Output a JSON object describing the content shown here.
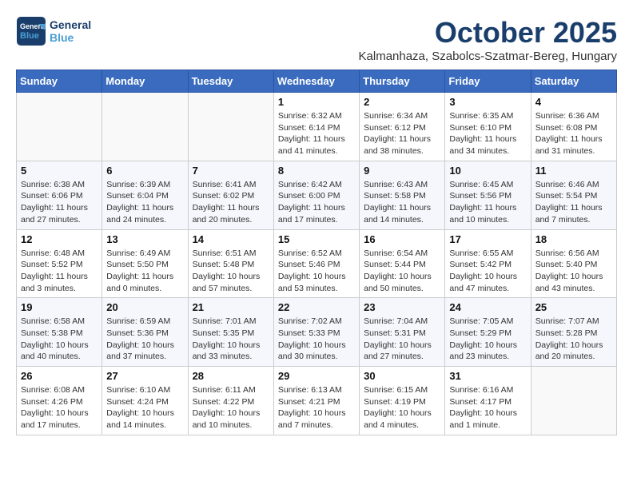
{
  "header": {
    "logo_general": "General",
    "logo_blue": "Blue",
    "month": "October 2025",
    "location": "Kalmanhaza, Szabolcs-Szatmar-Bereg, Hungary"
  },
  "days_of_week": [
    "Sunday",
    "Monday",
    "Tuesday",
    "Wednesday",
    "Thursday",
    "Friday",
    "Saturday"
  ],
  "weeks": [
    [
      {
        "day": "",
        "info": ""
      },
      {
        "day": "",
        "info": ""
      },
      {
        "day": "",
        "info": ""
      },
      {
        "day": "1",
        "info": "Sunrise: 6:32 AM\nSunset: 6:14 PM\nDaylight: 11 hours and 41 minutes."
      },
      {
        "day": "2",
        "info": "Sunrise: 6:34 AM\nSunset: 6:12 PM\nDaylight: 11 hours and 38 minutes."
      },
      {
        "day": "3",
        "info": "Sunrise: 6:35 AM\nSunset: 6:10 PM\nDaylight: 11 hours and 34 minutes."
      },
      {
        "day": "4",
        "info": "Sunrise: 6:36 AM\nSunset: 6:08 PM\nDaylight: 11 hours and 31 minutes."
      }
    ],
    [
      {
        "day": "5",
        "info": "Sunrise: 6:38 AM\nSunset: 6:06 PM\nDaylight: 11 hours and 27 minutes."
      },
      {
        "day": "6",
        "info": "Sunrise: 6:39 AM\nSunset: 6:04 PM\nDaylight: 11 hours and 24 minutes."
      },
      {
        "day": "7",
        "info": "Sunrise: 6:41 AM\nSunset: 6:02 PM\nDaylight: 11 hours and 20 minutes."
      },
      {
        "day": "8",
        "info": "Sunrise: 6:42 AM\nSunset: 6:00 PM\nDaylight: 11 hours and 17 minutes."
      },
      {
        "day": "9",
        "info": "Sunrise: 6:43 AM\nSunset: 5:58 PM\nDaylight: 11 hours and 14 minutes."
      },
      {
        "day": "10",
        "info": "Sunrise: 6:45 AM\nSunset: 5:56 PM\nDaylight: 11 hours and 10 minutes."
      },
      {
        "day": "11",
        "info": "Sunrise: 6:46 AM\nSunset: 5:54 PM\nDaylight: 11 hours and 7 minutes."
      }
    ],
    [
      {
        "day": "12",
        "info": "Sunrise: 6:48 AM\nSunset: 5:52 PM\nDaylight: 11 hours and 3 minutes."
      },
      {
        "day": "13",
        "info": "Sunrise: 6:49 AM\nSunset: 5:50 PM\nDaylight: 11 hours and 0 minutes."
      },
      {
        "day": "14",
        "info": "Sunrise: 6:51 AM\nSunset: 5:48 PM\nDaylight: 10 hours and 57 minutes."
      },
      {
        "day": "15",
        "info": "Sunrise: 6:52 AM\nSunset: 5:46 PM\nDaylight: 10 hours and 53 minutes."
      },
      {
        "day": "16",
        "info": "Sunrise: 6:54 AM\nSunset: 5:44 PM\nDaylight: 10 hours and 50 minutes."
      },
      {
        "day": "17",
        "info": "Sunrise: 6:55 AM\nSunset: 5:42 PM\nDaylight: 10 hours and 47 minutes."
      },
      {
        "day": "18",
        "info": "Sunrise: 6:56 AM\nSunset: 5:40 PM\nDaylight: 10 hours and 43 minutes."
      }
    ],
    [
      {
        "day": "19",
        "info": "Sunrise: 6:58 AM\nSunset: 5:38 PM\nDaylight: 10 hours and 40 minutes."
      },
      {
        "day": "20",
        "info": "Sunrise: 6:59 AM\nSunset: 5:36 PM\nDaylight: 10 hours and 37 minutes."
      },
      {
        "day": "21",
        "info": "Sunrise: 7:01 AM\nSunset: 5:35 PM\nDaylight: 10 hours and 33 minutes."
      },
      {
        "day": "22",
        "info": "Sunrise: 7:02 AM\nSunset: 5:33 PM\nDaylight: 10 hours and 30 minutes."
      },
      {
        "day": "23",
        "info": "Sunrise: 7:04 AM\nSunset: 5:31 PM\nDaylight: 10 hours and 27 minutes."
      },
      {
        "day": "24",
        "info": "Sunrise: 7:05 AM\nSunset: 5:29 PM\nDaylight: 10 hours and 23 minutes."
      },
      {
        "day": "25",
        "info": "Sunrise: 7:07 AM\nSunset: 5:28 PM\nDaylight: 10 hours and 20 minutes."
      }
    ],
    [
      {
        "day": "26",
        "info": "Sunrise: 6:08 AM\nSunset: 4:26 PM\nDaylight: 10 hours and 17 minutes."
      },
      {
        "day": "27",
        "info": "Sunrise: 6:10 AM\nSunset: 4:24 PM\nDaylight: 10 hours and 14 minutes."
      },
      {
        "day": "28",
        "info": "Sunrise: 6:11 AM\nSunset: 4:22 PM\nDaylight: 10 hours and 10 minutes."
      },
      {
        "day": "29",
        "info": "Sunrise: 6:13 AM\nSunset: 4:21 PM\nDaylight: 10 hours and 7 minutes."
      },
      {
        "day": "30",
        "info": "Sunrise: 6:15 AM\nSunset: 4:19 PM\nDaylight: 10 hours and 4 minutes."
      },
      {
        "day": "31",
        "info": "Sunrise: 6:16 AM\nSunset: 4:17 PM\nDaylight: 10 hours and 1 minute."
      },
      {
        "day": "",
        "info": ""
      }
    ]
  ]
}
